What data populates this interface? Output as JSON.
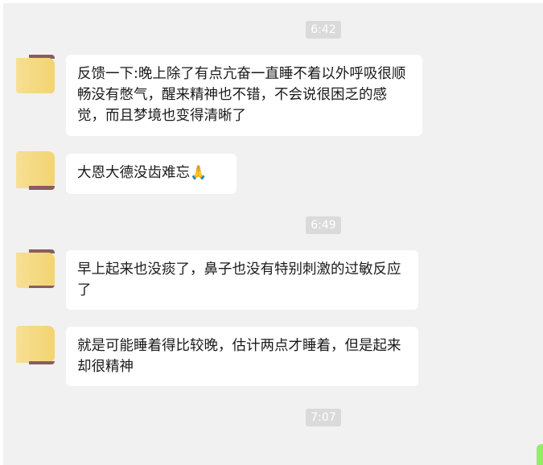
{
  "chat": {
    "timestamps": [
      "6:42",
      "6:49",
      "7:07"
    ],
    "messages": [
      {
        "text": "反馈一下:晚上除了有点亢奋一直睡不着以外呼吸很顺畅没有憋气，醒来精神也不错，不会说很困乏的感觉，而且梦境也变得清晰了"
      },
      {
        "text": "大恩大德没齿难忘",
        "emoji": "🙏"
      },
      {
        "text": "早上起来也没痰了，鼻子也没有特别刺激的过敏反应了"
      },
      {
        "text": "就是可能睡着得比较晚，估计两点才睡着，但是起来却很精神"
      }
    ]
  },
  "colors": {
    "background": "#f1f1f1",
    "bubble": "#ffffff",
    "timestamp_bg": "#dadada",
    "avatar_yellow": "#f6dd8e",
    "avatar_strip": "#8a5c60",
    "own_bubble_green": "#95ec69"
  }
}
